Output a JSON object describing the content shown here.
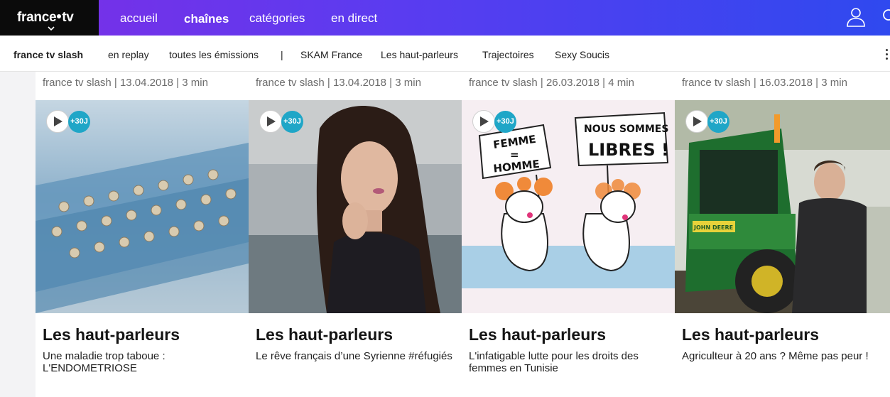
{
  "header": {
    "logo_text_a": "france",
    "logo_text_b": "tv",
    "nav": [
      {
        "label": "accueil",
        "active": false
      },
      {
        "label": "chaînes",
        "active": true
      },
      {
        "label": "catégories",
        "active": false
      },
      {
        "label": "en direct",
        "active": false
      }
    ],
    "icons": [
      "user-icon",
      "search-icon"
    ]
  },
  "subnav": {
    "brand": "france tv slash",
    "items": [
      "en replay",
      "toutes les émissions",
      "|",
      "SKAM France",
      "Les haut-parleurs",
      "Trajectoires",
      "Sexy Soucis"
    ]
  },
  "cards": [
    {
      "meta": "france tv slash | 13.04.2018 | 3 min",
      "badge": "+30J",
      "title": "Les haut-parleurs",
      "subtitle": "Une maladie trop taboue : L'ENDOMETRIOSE"
    },
    {
      "meta": "france tv slash | 13.04.2018 | 3 min",
      "badge": "+30J",
      "title": "Les haut-parleurs",
      "subtitle": "Le rêve français d’une Syrienne #réfugiés"
    },
    {
      "meta": "france tv slash | 26.03.2018 | 4 min",
      "badge": "+30J",
      "title": "Les haut-parleurs",
      "subtitle": "L'infatigable lutte pour les droits des femmes en Tunisie"
    },
    {
      "meta": "france tv slash | 16.03.2018 | 3 min",
      "badge": "+30J",
      "title": "Les haut-parleurs",
      "subtitle": "Agriculteur à 20 ans ? Même pas peur !"
    }
  ],
  "illustration_text": {
    "sign_left": [
      "FEMME",
      "=",
      "HOMME"
    ],
    "sign_right": [
      "NOUS SOMMES",
      "LIBRES !"
    ],
    "tractor_brand": "JOHN DEERE"
  },
  "colors": {
    "accent_badge": "#1fa6c7",
    "topbar_start": "#7c2ee6",
    "topbar_end": "#2f49ef"
  }
}
